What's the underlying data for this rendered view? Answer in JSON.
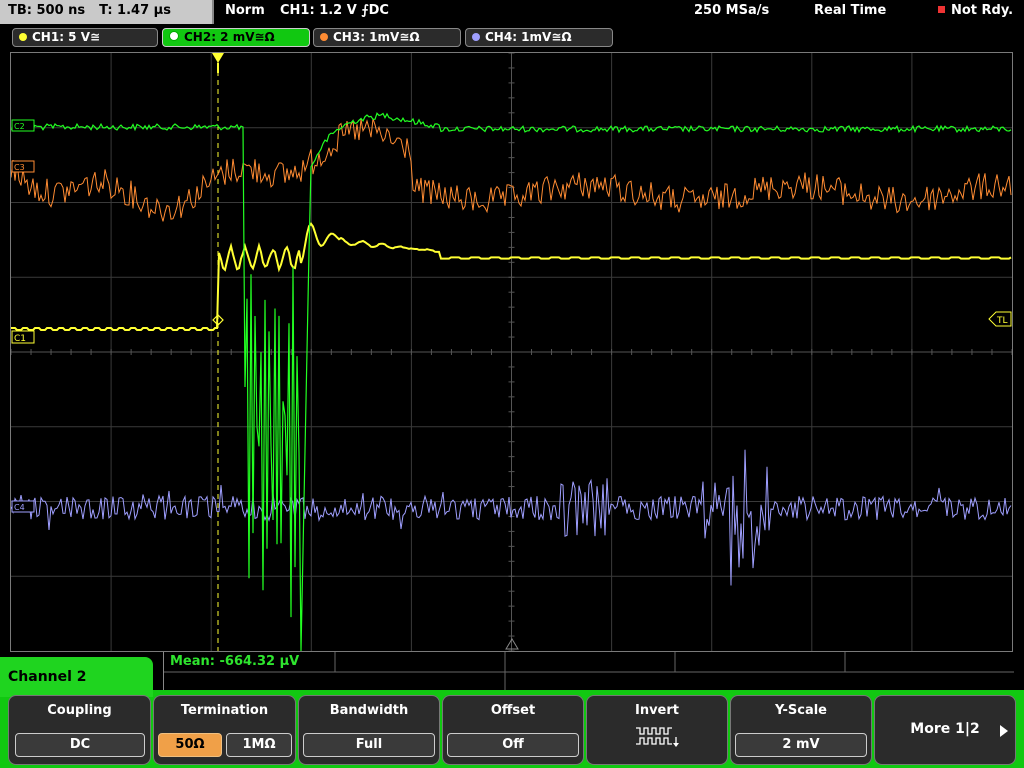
{
  "topbar": {
    "timebase": "TB: 500 ns",
    "trigger_time": "T: 1.47 µs",
    "mode": "Norm",
    "trigger": "CH1: 1.2 V ⨍DC",
    "sample_rate": "250 MSa/s",
    "acq_mode": "Real Time",
    "status": "Not Rdy."
  },
  "channels": [
    {
      "label": "CH1: 5 V≅",
      "color": "#ffff33"
    },
    {
      "label": "CH2: 2 mV≅Ω",
      "color": "#22ff22"
    },
    {
      "label": "CH3: 1mV≅Ω",
      "color": "#ff8c33"
    },
    {
      "label": "CH4: 1mV≅Ω",
      "color": "#9f9fff"
    }
  ],
  "markers": {
    "c1": "C1",
    "c2": "C2",
    "c3": "C3",
    "c4": "C4",
    "trigger_level": "TL"
  },
  "measurement": "Mean: -664.32 µV",
  "panel_title": "Channel 2",
  "softkeys": {
    "coupling": {
      "label": "Coupling",
      "value": "DC"
    },
    "termination": {
      "label": "Termination",
      "opt1": "50Ω",
      "opt2": "1MΩ"
    },
    "bandwidth": {
      "label": "Bandwidth",
      "value": "Full"
    },
    "offset": {
      "label": "Offset",
      "value": "Off"
    },
    "invert": {
      "label": "Invert"
    },
    "yscale": {
      "label": "Y-Scale",
      "value": "2 mV"
    },
    "more": {
      "label": "More 1|2"
    }
  },
  "colors": {
    "ch1": "#ffff33",
    "ch2": "#22ff22",
    "ch3": "#ff8c33",
    "ch4": "#9f9fff",
    "softkey_bar": "#11c811"
  }
}
